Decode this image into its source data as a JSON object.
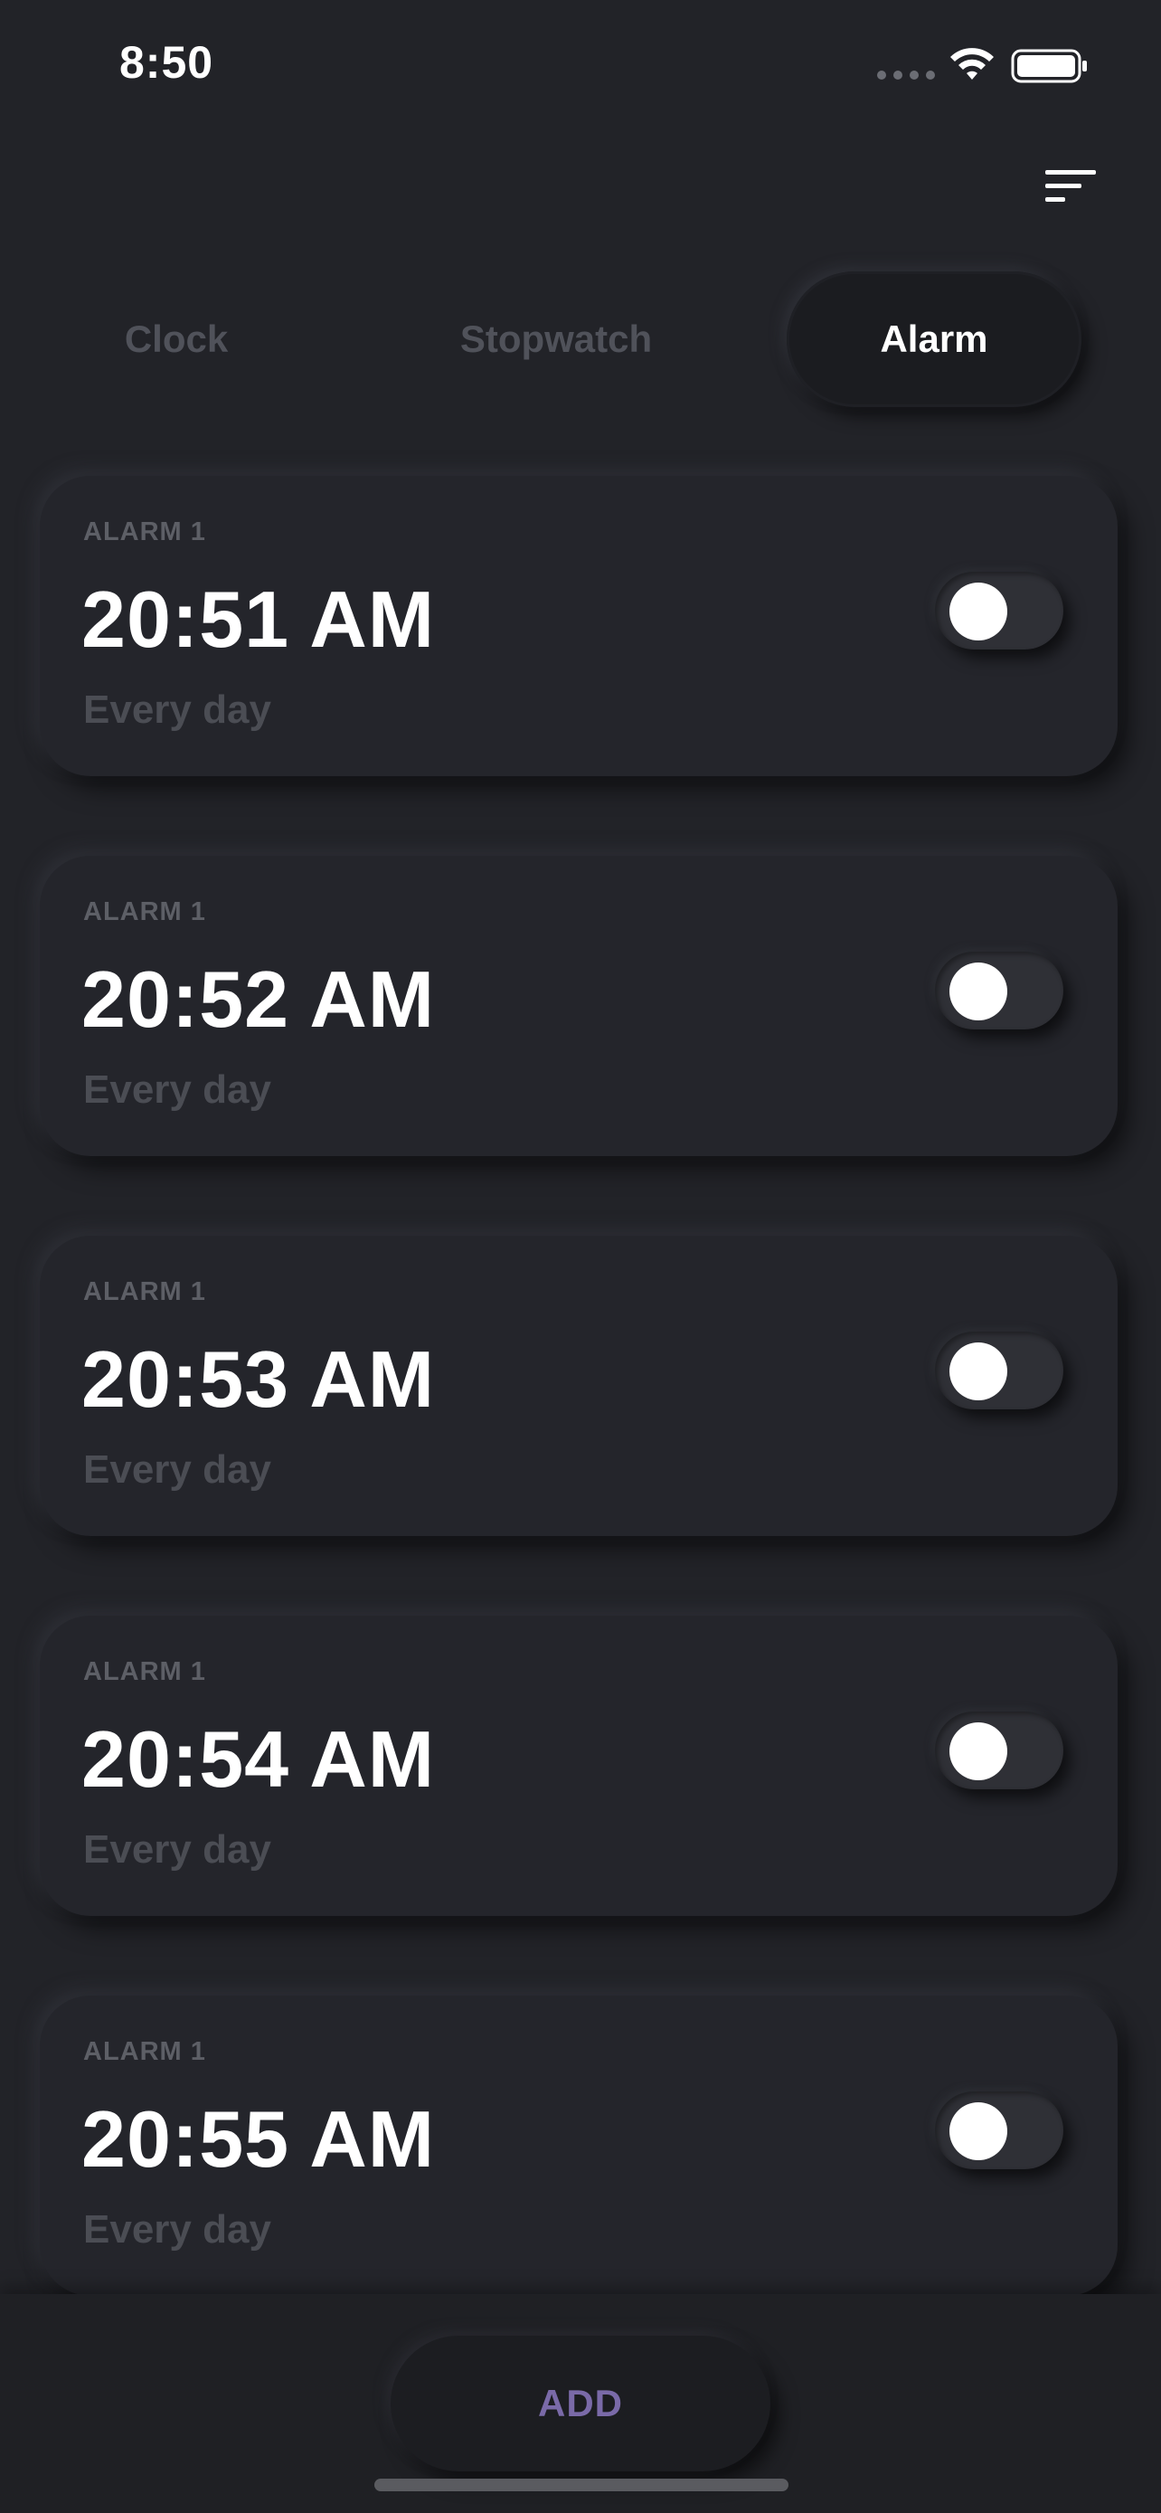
{
  "status_bar": {
    "time": "8:50",
    "icons": [
      "cellular-dots-icon",
      "wifi-icon",
      "battery-icon"
    ]
  },
  "header": {
    "menu_icon": "sort-lines-icon"
  },
  "tabs": [
    {
      "label": "Clock",
      "active": false
    },
    {
      "label": "Stopwatch",
      "active": false
    },
    {
      "label": "Alarm",
      "active": true
    }
  ],
  "alarms": [
    {
      "label": "ALARM 1",
      "time": "20:51 AM",
      "repeat": "Every day",
      "enabled": false
    },
    {
      "label": "ALARM 1",
      "time": "20:52 AM",
      "repeat": "Every day",
      "enabled": false
    },
    {
      "label": "ALARM 1",
      "time": "20:53 AM",
      "repeat": "Every day",
      "enabled": false
    },
    {
      "label": "ALARM 1",
      "time": "20:54 AM",
      "repeat": "Every day",
      "enabled": false
    },
    {
      "label": "ALARM 1",
      "time": "20:55 AM",
      "repeat": "Every day",
      "enabled": false
    }
  ],
  "footer": {
    "add_label": "ADD"
  },
  "colors": {
    "background": "#222328",
    "card": "#24252b",
    "accent": "#7a6aa8",
    "muted_text": "#4b4d54"
  }
}
